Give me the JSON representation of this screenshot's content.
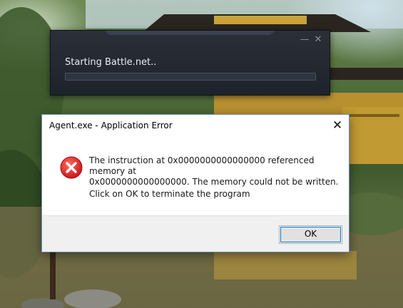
{
  "launcher": {
    "status": "Starting Battle.net..",
    "progress": 0.0,
    "minimize_glyph": "—",
    "close_glyph": "✕"
  },
  "dialog": {
    "title": "Agent.exe - Application Error",
    "close_glyph": "✕",
    "icon": "error-icon",
    "message_line1": "The instruction at 0x0000000000000000 referenced memory at",
    "message_line2": "0x0000000000000000. The memory could not be written.",
    "message2": "Click on OK to terminate the program",
    "ok_label": "OK"
  },
  "colors": {
    "error_red": "#e31b1b",
    "accent_focus": "#0078d7",
    "launcher_bg": "#232830"
  }
}
